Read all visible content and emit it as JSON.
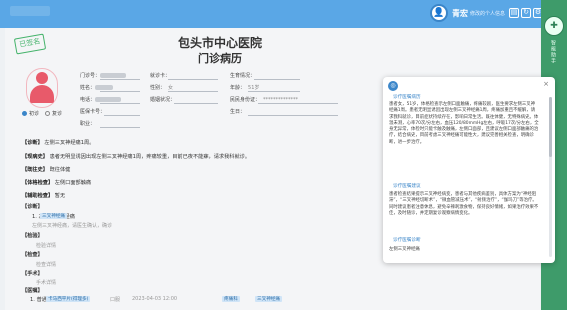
{
  "header": {
    "user_name": "青宏",
    "user_role": "修改的个人信息",
    "tools": [
      "template-icon",
      "refresh-icon",
      "settings-icon",
      "exit-icon"
    ]
  },
  "record": {
    "stamp": "已签名",
    "hospital": "包头市中心医院",
    "title": "门诊病历",
    "fields": {
      "clinic_no_label": "门诊号：",
      "name_label": "姓名：",
      "phone_label": "电话：",
      "insurance_label": "医保卡号：",
      "card_label": "就诊卡：",
      "gender_label": "性别：",
      "gender_value": "女",
      "age_label": "年龄：",
      "age_value": "51岁",
      "id_label": "民民身份证：",
      "id_value": "**************",
      "birth_label": "生日：",
      "marital_label": "婚姻状况：",
      "occupation_label": "职业：",
      "birthday_label": "生育情况："
    },
    "first_visit": "初诊",
    "revisit": "复诊",
    "sections": [
      {
        "label": "【诊断】",
        "text": "左侧三叉神经痛1周。"
      },
      {
        "label": "【现病史】",
        "text": "患者无明显诱因出现左侧三叉神经痛1周，疼痛较重，目前已夜不能寐，请求我科就诊。"
      },
      {
        "label": "【既往史】",
        "text": "既往体健"
      },
      {
        "label": "【体格检查】",
        "text": "左侧口面部触痛"
      },
      {
        "label": "【辅助检查】",
        "text": "暂无"
      }
    ],
    "diagnosis_label": "【诊断】",
    "diagnosis_item": "1. 左侧三叉神经痛",
    "diagnosis_tag": "三叉神经痛",
    "diagnosis_hint": "左侧三叉神经痛，请医生确认，确诊",
    "treatment_label": "【检验】",
    "treatment_hint": "检验详情",
    "exam_label": "【检查】",
    "exam_hint": "检查详情",
    "surgery_label": "【手术】",
    "surgery_hint": "手术详情",
    "advice_label": "【医嘱】",
    "advice_item": "1. 普通",
    "advice_detail": "卡马西平片(得理多)",
    "advice_prefix": "口服",
    "advice_date": "2023-04-03 12:00",
    "advice_tag1": "疼痛科",
    "advice_tag2": "三叉神经痛"
  },
  "panel": {
    "section1_title": "诊疗医嘱病历",
    "section1_text": "患者女，51岁，体格检查示左侧口面触痛，疼痛较剧，医生要求左侧三叉神经痛1周。患者无明显诱因出现左侧三叉神经痛1周，疼痛加重且不缓解，请求我科就诊，目前症状持续存在，影响日常生活。既往体健，无特殊病史。体温未测，心率70次/分左右，血压120/80mmHg左右，呼吸17次/分左右，全身无异常，体检时只能卡触及触痛，左侧口面部，且建议左侧口面部触痛的治疗，结合病史，目前考虑三叉神经痛可能性大，建议完善相关检查，明确诊断，进一步治疗。",
    "section2_title": "诊疗医嘱建议",
    "section2_text": "患者检查结果提示三叉神经病变，患者与其他疾病鉴别，具体方案为“神经阻滞”，“三叉神经切断术”，“微血管减压术”，“射频治疗”，“伽玛刀”等治疗。同时建议患者注意休息，避免辛辣刺激食物，保持良好情绪，如果治疗效果不佳，及时随诊，并定期复诊观察病情变化。",
    "section3_title": "诊疗医嘱诊断",
    "section3_text": "左侧三叉神经痛"
  },
  "side_tab": {
    "label": "智能助手"
  }
}
